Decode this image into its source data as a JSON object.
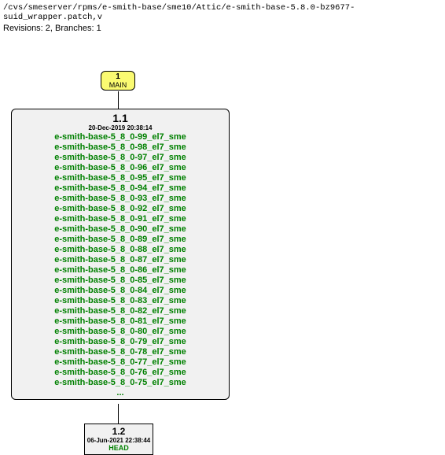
{
  "header": {
    "path": "/cvs/smeserver/rpms/e-smith-base/sme10/Attic/e-smith-base-5.8.0-bz9677-suid_wrapper.patch,v",
    "revisions_line": "Revisions: 2, Branches: 1"
  },
  "main_node": {
    "num": "1",
    "label": "MAIN"
  },
  "rev11": {
    "version": "1.1",
    "date": "20-Dec-2019 20:38:14",
    "tags": [
      "e-smith-base-5_8_0-99_el7_sme",
      "e-smith-base-5_8_0-98_el7_sme",
      "e-smith-base-5_8_0-97_el7_sme",
      "e-smith-base-5_8_0-96_el7_sme",
      "e-smith-base-5_8_0-95_el7_sme",
      "e-smith-base-5_8_0-94_el7_sme",
      "e-smith-base-5_8_0-93_el7_sme",
      "e-smith-base-5_8_0-92_el7_sme",
      "e-smith-base-5_8_0-91_el7_sme",
      "e-smith-base-5_8_0-90_el7_sme",
      "e-smith-base-5_8_0-89_el7_sme",
      "e-smith-base-5_8_0-88_el7_sme",
      "e-smith-base-5_8_0-87_el7_sme",
      "e-smith-base-5_8_0-86_el7_sme",
      "e-smith-base-5_8_0-85_el7_sme",
      "e-smith-base-5_8_0-84_el7_sme",
      "e-smith-base-5_8_0-83_el7_sme",
      "e-smith-base-5_8_0-82_el7_sme",
      "e-smith-base-5_8_0-81_el7_sme",
      "e-smith-base-5_8_0-80_el7_sme",
      "e-smith-base-5_8_0-79_el7_sme",
      "e-smith-base-5_8_0-78_el7_sme",
      "e-smith-base-5_8_0-77_el7_sme",
      "e-smith-base-5_8_0-76_el7_sme",
      "e-smith-base-5_8_0-75_el7_sme"
    ],
    "more": "..."
  },
  "rev12": {
    "version": "1.2",
    "date": "06-Jun-2021 22:38:44",
    "head": "HEAD"
  }
}
